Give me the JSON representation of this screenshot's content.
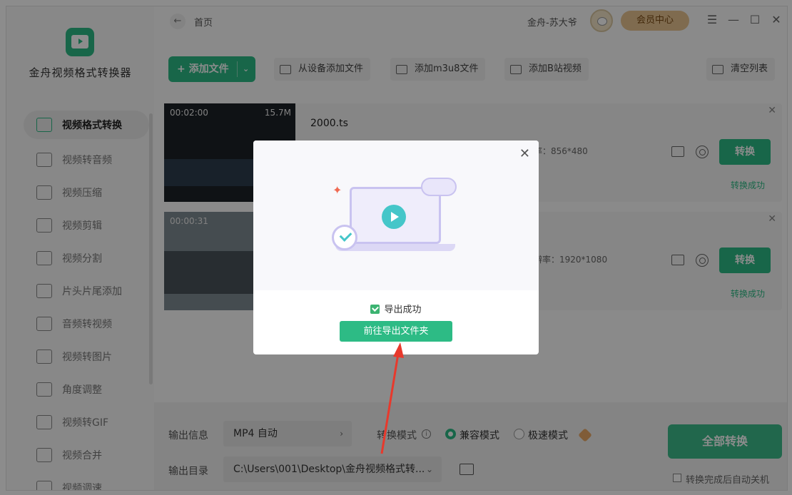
{
  "app": {
    "title": "金舟视频格式转换器"
  },
  "sidebar": {
    "items": [
      {
        "label": "视频格式转换",
        "icon": "format-convert-icon",
        "active": true
      },
      {
        "label": "视频转音频",
        "icon": "music-note-icon"
      },
      {
        "label": "视频压缩",
        "icon": "compress-icon"
      },
      {
        "label": "视频剪辑",
        "icon": "scissors-icon"
      },
      {
        "label": "视频分割",
        "icon": "split-icon"
      },
      {
        "label": "片头片尾添加",
        "icon": "film-strip-icon"
      },
      {
        "label": "音频转视频",
        "icon": "audio-disc-icon"
      },
      {
        "label": "视频转图片",
        "icon": "image-icon"
      },
      {
        "label": "角度调整",
        "icon": "rotate-icon"
      },
      {
        "label": "视频转GIF",
        "icon": "gif-icon"
      },
      {
        "label": "视频合并",
        "icon": "merge-icon"
      },
      {
        "label": "视频调速",
        "icon": "speed-icon"
      }
    ]
  },
  "topbar": {
    "back_icon": "←",
    "home_label": "首页",
    "user_name": "金舟-苏大爷",
    "vip_label": "会员中心",
    "window_controls": [
      "☰",
      "—",
      "☐",
      "✕"
    ]
  },
  "toolbar": {
    "add_file": "+ 添加文件",
    "add_file_caret": "⌄",
    "add_from_device": "从设备添加文件",
    "add_m3u8": "添加m3u8文件",
    "add_bilibili": "添加B站视频",
    "clear_list": "清空列表"
  },
  "files": [
    {
      "name": "2000.ts",
      "duration": "00:02:00",
      "size": "15.7M",
      "resolution": "率：856*480",
      "convert_label": "转换",
      "status": "转换成功",
      "close": "✕"
    },
    {
      "name": "",
      "duration": "00:00:31",
      "size": "",
      "resolution": "辨率：1920*1080",
      "convert_label": "转换",
      "status": "转换成功",
      "close": "✕"
    }
  ],
  "bottom": {
    "output_info_label": "输出信息",
    "output_format": "MP4 自动",
    "output_format_chevron": "›",
    "convert_mode_label": "转换模式",
    "info_glyph": "i",
    "mode_compatible": "兼容模式",
    "mode_fast": "极速模式",
    "output_dir_label": "输出目录",
    "output_dir": "C:\\Users\\001\\Desktop\\金舟视频格式转...",
    "output_dir_chevron": "⌄",
    "convert_all": "全部转换",
    "auto_shutdown": "转换完成后自动关机"
  },
  "dialog": {
    "close": "✕",
    "sparkle": "✦",
    "success_text": "导出成功",
    "open_folder_button": "前往导出文件夹"
  },
  "colors": {
    "accent": "#2dbb85",
    "vip": "#e8c491",
    "annotation_arrow": "#e8392c"
  }
}
